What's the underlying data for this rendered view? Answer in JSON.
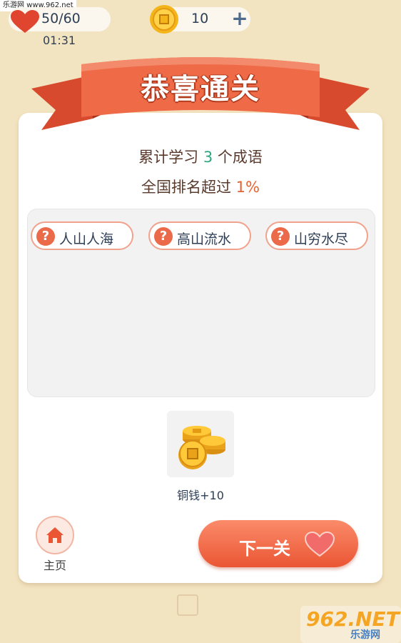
{
  "watermark_top": "乐游网 www.962.net",
  "status": {
    "lives": "50/60",
    "timer": "01:31",
    "coins": "10"
  },
  "banner": {
    "title": "恭喜通关"
  },
  "stats": {
    "line1_prefix": "累计学习",
    "line1_value": "3",
    "line1_suffix": "个成语",
    "line2_prefix": "全国排名超过",
    "line2_value": "1%"
  },
  "idioms": [
    "人山人海",
    "高山流水",
    "山穷水尽"
  ],
  "reward": {
    "label": "铜钱+10"
  },
  "actions": {
    "home_label": "主页",
    "next_label": "下一关"
  },
  "watermark_logo": {
    "big": "962.NET",
    "small": "乐游网"
  },
  "colors": {
    "background": "#f3e4c1",
    "accent": "#ea5634",
    "count_green": "#2ea77e",
    "rank_orange": "#e6622e"
  }
}
